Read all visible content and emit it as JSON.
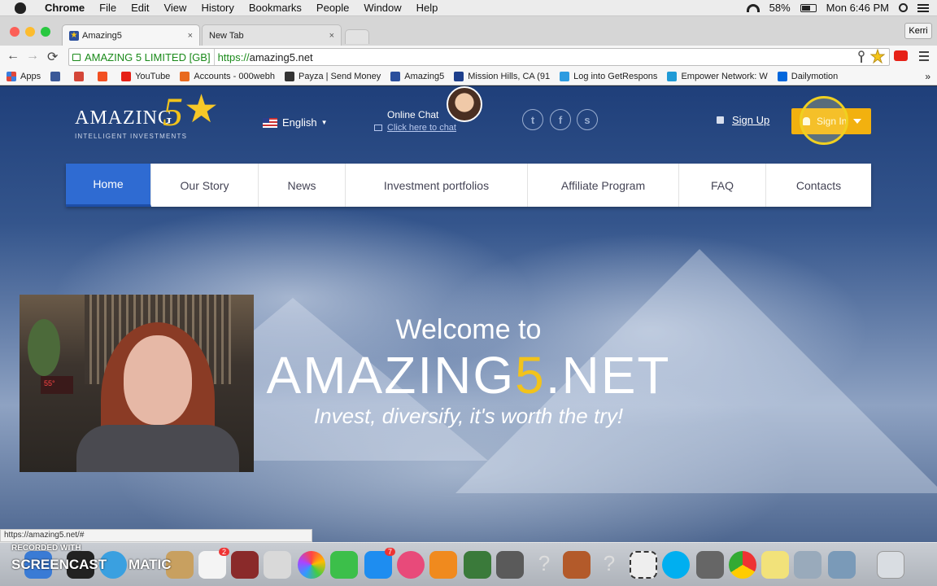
{
  "menubar": {
    "app": "Chrome",
    "items": [
      "File",
      "Edit",
      "View",
      "History",
      "Bookmarks",
      "People",
      "Window",
      "Help"
    ],
    "battery": "58%",
    "clock": "Mon 6:46 PM"
  },
  "tabs": [
    {
      "title": "Amazing5",
      "close": "×"
    },
    {
      "title": "New Tab",
      "close": "×"
    }
  ],
  "profile": "Kerri",
  "toolbar": {
    "back": "←",
    "forward": "→",
    "reload": "⟳",
    "ev_label": "AMAZING 5 LIMITED [GB]",
    "url_proto": "https://",
    "url_host": "amazing5.net"
  },
  "bookmarks": [
    {
      "label": "Apps",
      "color": "#e0463a"
    },
    {
      "label": "",
      "color": "#3b5998"
    },
    {
      "label": "",
      "color": "#d44638"
    },
    {
      "label": "",
      "color": "#f25022"
    },
    {
      "label": "YouTube",
      "color": "#e62117"
    },
    {
      "label": "Accounts - 000webh",
      "color": "#e96a1e"
    },
    {
      "label": "Payza | Send Money",
      "color": "#333333"
    },
    {
      "label": "Amazing5",
      "color": "#2b4f9c"
    },
    {
      "label": "Mission Hills, CA (91",
      "color": "#1d3f8c"
    },
    {
      "label": "Log into GetRespons",
      "color": "#2d9be0"
    },
    {
      "label": "Empower Network: W",
      "color": "#1f9ad6"
    },
    {
      "label": "Dailymotion",
      "color": "#0066dc"
    }
  ],
  "site": {
    "logo_text": "AMAZING",
    "logo_five": "5",
    "logo_sub": "INTELLIGENT INVESTMENTS",
    "language": "English",
    "chat_title": "Online Chat",
    "chat_link": "Click here to chat",
    "social": [
      "t",
      "f",
      "s"
    ],
    "signup": "Sign Up",
    "signin": "Sign In",
    "nav": [
      "Home",
      "Our Story",
      "News",
      "Investment portfolios",
      "Affiliate Program",
      "FAQ",
      "Contacts"
    ],
    "welcome": "Welcome to",
    "brand_pre": "AMAZING",
    "brand_five": "5",
    "brand_post": ".NET",
    "tagline": "Invest, diversify, it's worth the try!"
  },
  "webcam": {
    "tv_text": "55°"
  },
  "status_url": "https://amazing5.net/#",
  "watermark": {
    "recorded": "RECORDED WITH",
    "screencast": "SCREENCAST",
    "matic": "MATIC"
  },
  "dock_badges": {
    "reminders": "2",
    "appstore": "7"
  }
}
